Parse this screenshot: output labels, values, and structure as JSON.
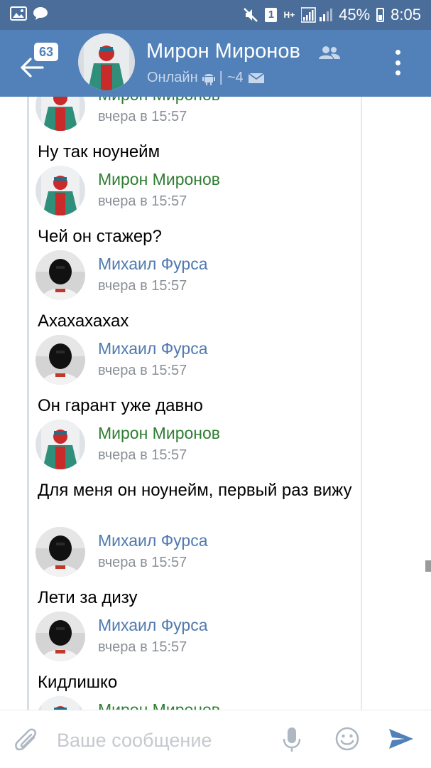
{
  "status_bar": {
    "sim": "1",
    "network": "H+",
    "battery": "45%",
    "time": "8:05",
    "icons": [
      "gallery-icon",
      "chat-bubble-icon",
      "mute-icon",
      "signal-icon",
      "battery-icon"
    ]
  },
  "header": {
    "badge": "63",
    "title": "Мирон Миронов",
    "status": "Онлайн",
    "members": "~4",
    "icons": [
      "back-arrow-icon",
      "group-icon",
      "android-icon",
      "mail-icon",
      "more-vertical-icon"
    ]
  },
  "messages": [
    {
      "sender": "Мирон Миронов",
      "time": "вчера в 15:57",
      "text": "Ну так ноунейм",
      "color": "#2e7d32",
      "avatar": "avatar-miron"
    },
    {
      "sender": "Мирон Миронов",
      "time": "вчера в 15:57",
      "text": "Чей он стажер?",
      "color": "#2e7d32",
      "avatar": "avatar-miron"
    },
    {
      "sender": "Михаил Фурса",
      "time": "вчера в 15:57",
      "text": "Ахахахахах",
      "color": "#4f7ab0",
      "avatar": "avatar-mikhail"
    },
    {
      "sender": "Михаил Фурса",
      "time": "вчера в 15:57",
      "text": "Он гарант уже давно",
      "color": "#4f7ab0",
      "avatar": "avatar-mikhail"
    },
    {
      "sender": "Мирон Миронов",
      "time": "вчера в 15:57",
      "text": "Для меня он ноунейм, первый раз вижу",
      "color": "#2e7d32",
      "avatar": "avatar-miron"
    },
    {
      "sender": "Михаил Фурса",
      "time": "вчера в 15:57",
      "text": "Лети за дизу",
      "color": "#4f7ab0",
      "avatar": "avatar-mikhail"
    },
    {
      "sender": "Михаил Фурса",
      "time": "вчера в 15:57",
      "text": "Кидлишко",
      "color": "#4f7ab0",
      "avatar": "avatar-mikhail"
    },
    {
      "sender": "Мирон Миронов",
      "color": "#2e7d32",
      "avatar": "avatar-miron"
    }
  ],
  "composer": {
    "placeholder": "Ваше сообщение",
    "value": "",
    "icons": [
      "paperclip-icon",
      "microphone-icon",
      "emoji-icon",
      "send-icon"
    ]
  },
  "colors": {
    "status_bar": "#4a6e99",
    "header": "#5181b8",
    "accent": "#5181b8",
    "sender_green": "#2e7d32",
    "sender_blue": "#4f7ab0",
    "timestamp": "#8a8f96"
  }
}
